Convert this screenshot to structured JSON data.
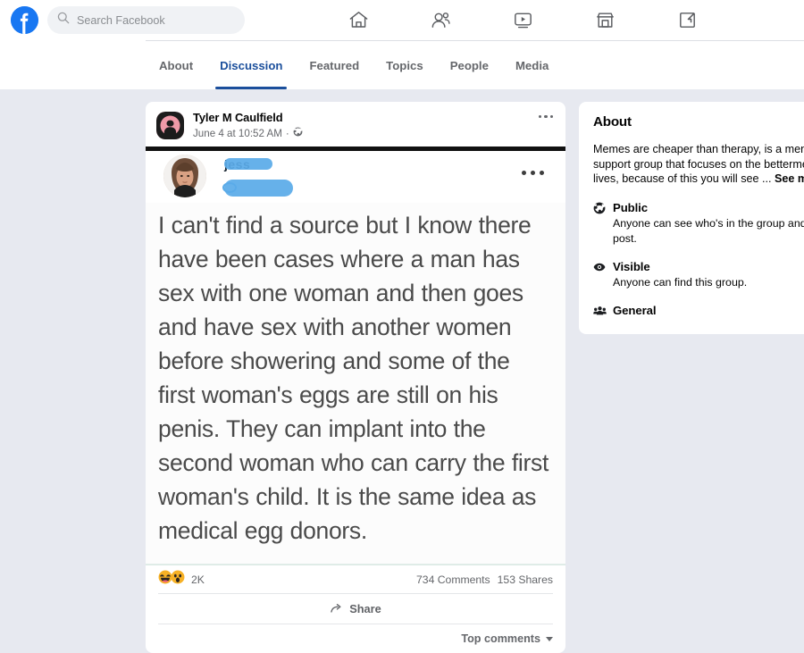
{
  "topbar": {
    "logo_alt": "Facebook",
    "search": {
      "placeholder": "Search Facebook",
      "value": ""
    },
    "nav": [
      {
        "name": "home",
        "label": "Home"
      },
      {
        "name": "friends",
        "label": "Friends"
      },
      {
        "name": "watch",
        "label": "Watch"
      },
      {
        "name": "marketplace",
        "label": "Marketplace"
      },
      {
        "name": "gaming",
        "label": "Gaming"
      }
    ]
  },
  "tabs": [
    {
      "label": "About",
      "active": false
    },
    {
      "label": "Discussion",
      "active": true
    },
    {
      "label": "Featured",
      "active": false
    },
    {
      "label": "Topics",
      "active": false
    },
    {
      "label": "People",
      "active": false
    },
    {
      "label": "Media",
      "active": false
    }
  ],
  "post": {
    "author": "Tyler M Caulfield",
    "timestamp": "June 4 at 10:52 AM",
    "separator": "·",
    "audience_icon": "globe-icon",
    "menu_icon": "more-options-icon",
    "embed": {
      "author_redacted_text": "jess",
      "redaction_note": "name and timestamp covered with blue marker scribble",
      "menu_icon": "more-options-icon",
      "text": "I can't find a source but I know there have been cases where a man has sex with one woman and then goes and have sex with another women before showering and some of the first woman's eggs are still on his penis. They can implant into the second woman who can carry the first woman's child. It is the same idea as medical egg donors."
    },
    "reactions": {
      "emojis": [
        "haha",
        "wow"
      ],
      "count": "2K"
    },
    "comments": "734 Comments",
    "shares": "153 Shares",
    "share_button": "Share",
    "sort": "Top comments"
  },
  "about": {
    "title": "About",
    "description": "Memes are cheaper than therapy, is a menta",
    "description_line2": "support group that focuses on the betterme",
    "description_line3": "lives, because of this you will see ...",
    "see_more": "See mor",
    "rows": [
      {
        "icon": "globe-icon",
        "heading": "Public",
        "sub": "Anyone can see who's in the group and",
        "sub2": "post."
      },
      {
        "icon": "eye-icon",
        "heading": "Visible",
        "sub": "Anyone can find this group.",
        "sub2": ""
      },
      {
        "icon": "people-group-icon",
        "heading": "General",
        "sub": "",
        "sub2": ""
      }
    ]
  },
  "colors": {
    "brand_blue": "#1877f2",
    "active_tab": "#1b4f9c",
    "page_bg": "#e7e9f0",
    "card_bg": "#ffffff",
    "secondary_text": "#65676b",
    "redaction_blue": "#5aabe8"
  }
}
